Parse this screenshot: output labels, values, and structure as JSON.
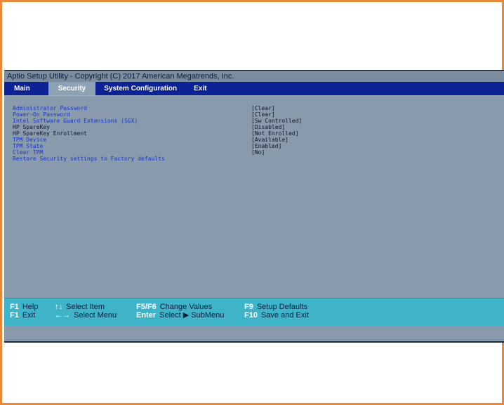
{
  "window": {
    "title": "Aptio Setup Utility - Copyright (C) 2017 American Megatrends, Inc."
  },
  "menubar": {
    "tabs": [
      {
        "label": "Main"
      },
      {
        "label": "Security"
      },
      {
        "label": "System Configuration"
      },
      {
        "label": "Exit"
      }
    ],
    "active": "Security"
  },
  "security": {
    "items": [
      {
        "label": "Administrator Password",
        "value": "[Clear]"
      },
      {
        "label": "Power-On Password",
        "value": "[Clear]"
      },
      {
        "label": "Intel Software Guard Extensions (SGX)",
        "value": "[Sw Controlled]"
      },
      {
        "label": "HP SpareKey",
        "value": "[Disabled]"
      },
      {
        "label": "HP SpareKey Enrollment",
        "value": "[Not Enrolled]"
      },
      {
        "label": "TPM Device",
        "value": "[Available]"
      },
      {
        "label": "TPM State",
        "value": "[Enabled]"
      },
      {
        "label": "Clear TPM",
        "value": "[No]"
      },
      {
        "label": "Restore Security settings to Factory defaults",
        "value": ""
      }
    ]
  },
  "footer": {
    "help": {
      "key": "F1",
      "desc": "Help"
    },
    "exit": {
      "key": "F1",
      "desc": "Exit"
    },
    "select_item": {
      "key": "↑↓",
      "desc": "Select Item"
    },
    "select_menu": {
      "key": "←→",
      "desc": "Select Menu"
    },
    "change_values": {
      "key": "F5/F6",
      "desc": "Change Values"
    },
    "select_submenu": {
      "key": "Enter",
      "desc": "Select ▶ SubMenu"
    },
    "setup_defaults": {
      "key": "F9",
      "desc": "Setup Defaults"
    },
    "save_exit": {
      "key": "F10",
      "desc": "Save and Exit"
    }
  },
  "colors": {
    "frame_border": "#e8893a",
    "menubar_bg": "#0b2395",
    "active_tab_bg": "#8fa1b4",
    "body_bg": "#8a9aad",
    "footer_bg": "#3fb4c8",
    "item_text": "#1736c9"
  }
}
